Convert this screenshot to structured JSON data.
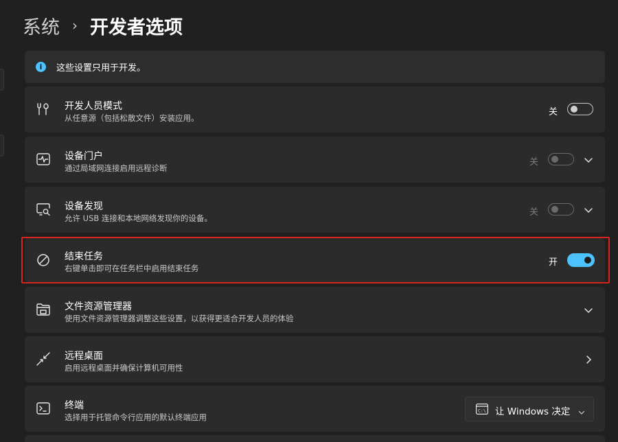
{
  "breadcrumb": {
    "parent": "系统",
    "separator": "›",
    "current": "开发者选项"
  },
  "info_bar": {
    "icon": "info-icon",
    "text": "这些设置只用于开发。"
  },
  "rows": [
    {
      "icon": "tools-icon",
      "title": "开发人员模式",
      "description": "从任意源（包括松散文件）安装应用。",
      "toggle_label": "关",
      "toggle_on": false,
      "enabled": true,
      "trailing": "none"
    },
    {
      "icon": "device-portal-icon",
      "title": "设备门户",
      "description": "通过局域网连接启用远程诊断",
      "toggle_label": "关",
      "toggle_on": false,
      "enabled": false,
      "trailing": "chevron-down"
    },
    {
      "icon": "device-discovery-icon",
      "title": "设备发现",
      "description": "允许 USB 连接和本地网络发现你的设备。",
      "toggle_label": "关",
      "toggle_on": false,
      "enabled": false,
      "trailing": "chevron-down"
    },
    {
      "icon": "end-task-icon",
      "title": "结束任务",
      "description": "右键单击即可在任务栏中启用结束任务",
      "toggle_label": "开",
      "toggle_on": true,
      "enabled": true,
      "trailing": "none"
    },
    {
      "icon": "file-explorer-icon",
      "title": "文件资源管理器",
      "description": "使用文件资源管理器调整这些设置，以获得更适合开发人员的体验",
      "trailing": "chevron-down"
    },
    {
      "icon": "remote-desktop-icon",
      "title": "远程桌面",
      "description": "启用远程桌面并确保计算机可用性",
      "trailing": "chevron-right"
    },
    {
      "icon": "terminal-icon",
      "title": "终端",
      "description": "选择用于托管命令行应用的默认终端应用",
      "trailing": "dropdown"
    }
  ],
  "terminal_dropdown": {
    "icon": "console-icon",
    "value": "让 Windows 决定"
  },
  "colors": {
    "accent": "#4cc2ff",
    "background": "#202020",
    "card": "#2b2b2b",
    "highlight_border": "#d8261e"
  }
}
